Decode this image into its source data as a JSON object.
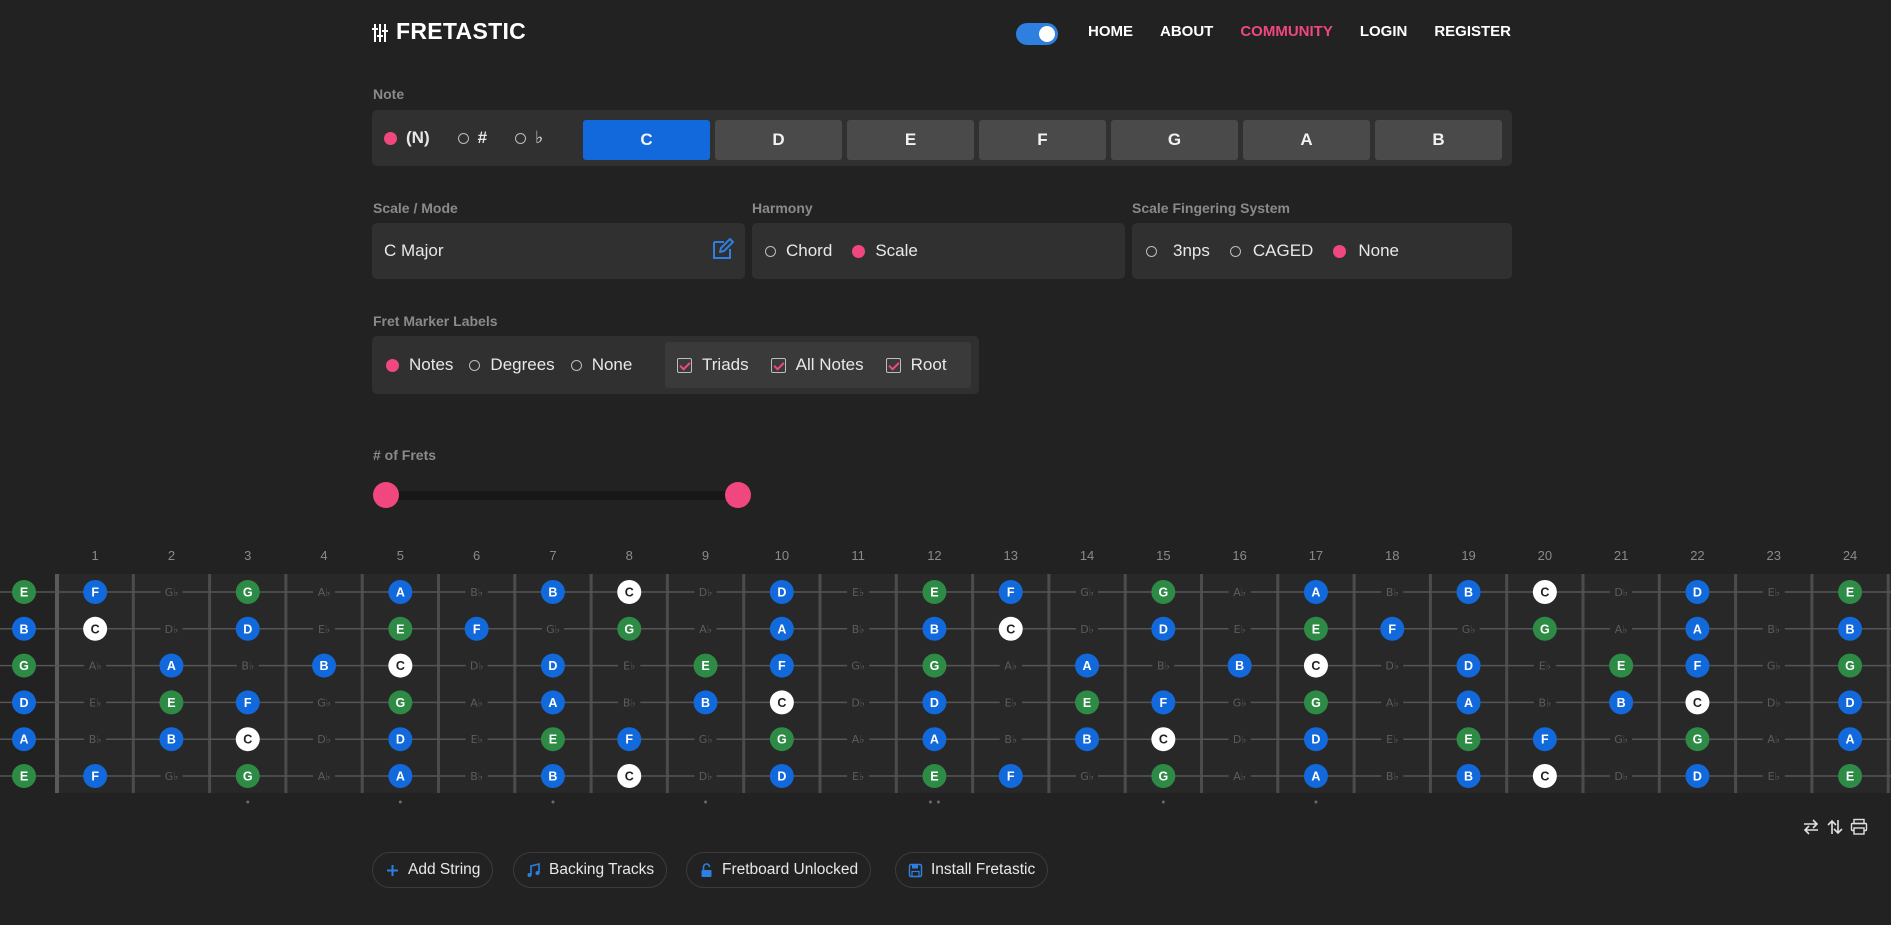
{
  "app": {
    "name": "FRETASTIC",
    "nav": [
      {
        "label": "HOME",
        "active": false
      },
      {
        "label": "ABOUT",
        "active": false
      },
      {
        "label": "COMMUNITY",
        "active": true
      },
      {
        "label": "LOGIN",
        "active": false
      },
      {
        "label": "REGISTER",
        "active": false
      }
    ],
    "theme_toggle_on": true
  },
  "note": {
    "label": "Note",
    "accidentals": [
      {
        "label": "(N)",
        "selected": true
      },
      {
        "label": "#",
        "selected": false
      },
      {
        "label": "♭",
        "selected": false
      }
    ],
    "notes": [
      "C",
      "D",
      "E",
      "F",
      "G",
      "A",
      "B"
    ],
    "selected": "C"
  },
  "scale": {
    "label": "Scale / Mode",
    "value": "C Major"
  },
  "harmony": {
    "label": "Harmony",
    "options": [
      "Chord",
      "Scale"
    ],
    "selected": "Scale"
  },
  "fingering": {
    "label": "Scale Fingering System",
    "options": [
      "3nps",
      "CAGED",
      "None"
    ],
    "selected": "None"
  },
  "fret_labels": {
    "label": "Fret Marker Labels",
    "radio_options": [
      "Notes",
      "Degrees",
      "None"
    ],
    "selected": "Notes",
    "checkboxes": [
      {
        "label": "Triads",
        "checked": true
      },
      {
        "label": "All Notes",
        "checked": true
      },
      {
        "label": "Root",
        "checked": true
      }
    ]
  },
  "frets": {
    "label": "# of Frets",
    "range": [
      0,
      24
    ]
  },
  "fretboard": {
    "fret_numbers": [
      "1",
      "2",
      "3",
      "4",
      "5",
      "6",
      "7",
      "8",
      "9",
      "10",
      "11",
      "12",
      "13",
      "14",
      "15",
      "16",
      "17",
      "18",
      "19",
      "20",
      "21",
      "22",
      "23",
      "24"
    ],
    "strings": [
      "E",
      "B",
      "G",
      "D",
      "A",
      "E"
    ],
    "open_strings": [
      "E",
      "B",
      "G",
      "D",
      "A",
      "E"
    ],
    "chromatic": [
      "C",
      "D♭",
      "D",
      "E♭",
      "E",
      "F",
      "G♭",
      "G",
      "A♭",
      "A",
      "B♭",
      "B"
    ],
    "scale_notes": [
      "C",
      "D",
      "E",
      "F",
      "G",
      "A",
      "B"
    ],
    "root": "C",
    "triad": [
      "C",
      "E",
      "G"
    ],
    "inlay_frets": [
      3,
      5,
      7,
      9,
      12,
      15,
      17
    ],
    "colors": {
      "root": "#ffffff",
      "triad": "#2e8b45",
      "scale": "#1269dc",
      "muted_label": "#5c5c5c",
      "accent": "#f0487e",
      "board": "#282828"
    }
  },
  "toolbar_icons": [
    "swap-horizontal-icon",
    "swap-vertical-icon",
    "print-icon"
  ],
  "actions": [
    {
      "label": "Add String",
      "icon": "plus-icon"
    },
    {
      "label": "Backing Tracks",
      "icon": "music-note-icon"
    },
    {
      "label": "Fretboard Unlocked",
      "icon": "unlock-icon"
    },
    {
      "label": "Install Fretastic",
      "icon": "save-icon"
    }
  ]
}
